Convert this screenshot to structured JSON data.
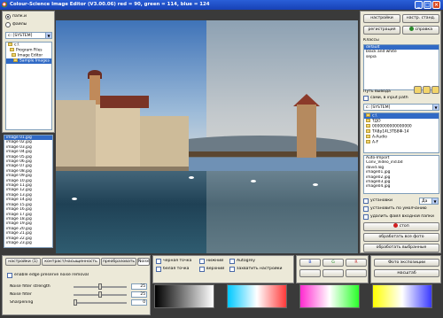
{
  "window": {
    "title": "Colour-Science Image Editor (V3.00.06) red = 90, green = 114, blue = 124"
  },
  "left_panel": {
    "options": [
      {
        "label": "папк.и",
        "selected": true
      },
      {
        "label": "файлы",
        "selected": false
      }
    ],
    "drive": "c: [SYSTEM]",
    "tree": [
      "c:\\",
      "Program Files",
      "Image Editor",
      "Sample Images"
    ],
    "files": [
      "image 01.jpg",
      "image 02.jpg",
      "image 03.jpg",
      "image 04.jpg",
      "image 05.jpg",
      "image 06.jpg",
      "image 07.jpg",
      "image 08.jpg",
      "image 09.jpg",
      "image 10.jpg",
      "image 11.jpg",
      "image 12.jpg",
      "image 13.jpg",
      "image 14.jpg",
      "image 15.jpg",
      "image 16.jpg",
      "image 17.jpg",
      "image 18.jpg",
      "image 19.jpg",
      "image 20.jpg",
      "image 21.jpg",
      "image 22.jpg",
      "image 23.jpg"
    ]
  },
  "right_panel": {
    "tabs": [
      "настройки",
      "настр. станд."
    ],
    "register_label": "регистрация",
    "help_label": "справка",
    "presets_label": "Классы",
    "presets": [
      "default",
      "black and white",
      "sepia"
    ],
    "output_label": "Путь вывода",
    "same_path_label": "сами, в input path",
    "out_drive": "c: [SYSTEM]",
    "out_tree": [
      "c:\\",
      "ТДО",
      "0000000000000000",
      "ТА8р14L3ТБ8Ф-14",
      "A-Audio",
      "A-F"
    ],
    "out_files": [
      "Auto-Import",
      "Conv_Video_ind.bd",
      "david.log",
      "image01.jpg",
      "image02.jpg",
      "image03.jpg",
      "image04.jpg"
    ],
    "opt1_label": "установки",
    "opt1_value": "Да",
    "opt2_label": "установить по умолчанию",
    "opt3_label": "удалить файл входной папки",
    "cancel_label": "стоп",
    "process_all_label": "обработать все фото",
    "process_selected_label": "обработать выбранные"
  },
  "bottom": {
    "tabs": [
      "настройки (1)",
      "контраст/насыщенность",
      "преобразовать",
      "Noise"
    ],
    "enable_label": "enable edge preserve noise removal",
    "sliders": [
      {
        "label": "Noise filter strength",
        "value": "25"
      },
      {
        "label": "Noise filter",
        "value": "25"
      },
      {
        "label": "Sharpening",
        "value": "0"
      }
    ],
    "checks": [
      {
        "label": "черная точка"
      },
      {
        "label": "белая точка"
      },
      {
        "label": "нижний"
      },
      {
        "label": "верхний"
      },
      {
        "label": "Autogrey"
      },
      {
        "label": "захватить настройки"
      }
    ],
    "rgb_buttons": [
      "B",
      "G",
      "R"
    ],
    "value_label": "Фото экспозиции",
    "value_sub": "масштаб"
  }
}
